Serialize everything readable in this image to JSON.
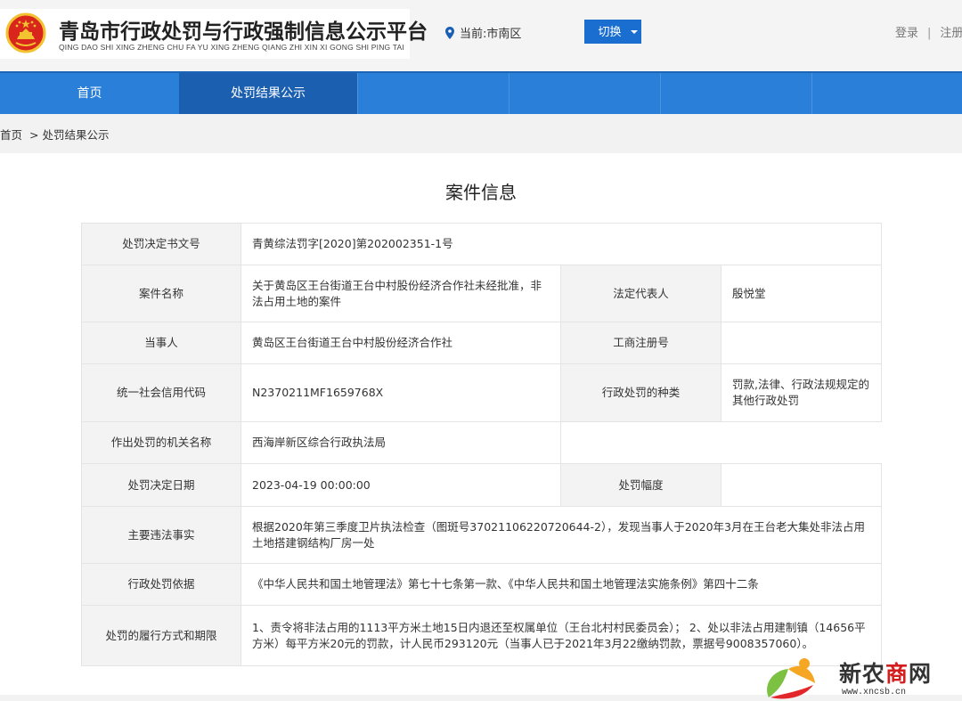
{
  "header": {
    "site_title": "青岛市行政处罚与行政强制信息公示平台",
    "site_subtitle": "QING DAO SHI XING ZHENG CHU FA YU XING ZHENG QIANG ZHI XIN XI GONG SHI PING TAI",
    "location_text": "当前:市南区",
    "switch_label": "切换",
    "login_label": "登录",
    "separator": "|",
    "register_label": "注册"
  },
  "nav": {
    "items": [
      {
        "label": "首页"
      },
      {
        "label": "处罚结果公示"
      }
    ]
  },
  "breadcrumb": {
    "home": "首页",
    "sep": ">",
    "current": "处罚结果公示"
  },
  "main": {
    "title": "案件信息",
    "rows": {
      "doc_no": {
        "label": "处罚决定书文号",
        "value": "青黄综法罚字[2020]第202002351-1号"
      },
      "case_name": {
        "label": "案件名称",
        "value": "关于黄岛区王台街道王台中村股份经济合作社未经批准，非法占用土地的案件"
      },
      "legal_rep": {
        "label": "法定代表人",
        "value": "殷悦堂"
      },
      "party": {
        "label": "当事人",
        "value": "黄岛区王台街道王台中村股份经济合作社"
      },
      "reg_no": {
        "label": "工商注册号",
        "value": ""
      },
      "credit_code": {
        "label": "统一社会信用代码",
        "value": "N2370211MF1659768X"
      },
      "penalty_type": {
        "label": "行政处罚的种类",
        "value": "罚款,法律、行政法规规定的其他行政处罚"
      },
      "authority": {
        "label": "作出处罚的机关名称",
        "value": "西海岸新区综合行政执法局"
      },
      "decision_date": {
        "label": "处罚决定日期",
        "value": "2023-04-19 00:00:00"
      },
      "penalty_range": {
        "label": "处罚幅度",
        "value": ""
      },
      "facts": {
        "label": "主要违法事实",
        "value": "根据2020年第三季度卫片执法检查（图斑号37021106220720644-2），发现当事人于2020年3月在王台老大集处非法占用土地搭建钢结构厂房一处"
      },
      "basis": {
        "label": "行政处罚依据",
        "value": "《中华人民共和国土地管理法》第七十七条第一款、《中华人民共和国土地管理法实施条例》第四十二条"
      },
      "performance": {
        "label": "处罚的履行方式和期限",
        "value": "1、责令将非法占用的1113平方米土地15日内退还至权属单位（王台北村村民委员会）； 2、处以非法占用建制镇（14656平方米）每平方米20元的罚款，计人民币293120元（当事人已于2021年3月22缴纳罚款，票据号9008357060）。"
      }
    }
  },
  "watermark": {
    "brand_part1": "新农",
    "brand_red": "商",
    "brand_part2": "网",
    "url": "www.xncsb.cn"
  },
  "colors": {
    "nav_bg": "#2a7fd9",
    "nav_active": "#1b5fb0",
    "switch_btn": "#1a6ecf",
    "label_bg": "#f3f3f3"
  },
  "icons": [
    "national-emblem-icon",
    "location-pin-icon",
    "chevron-down-icon",
    "watermark-logo-icon"
  ]
}
